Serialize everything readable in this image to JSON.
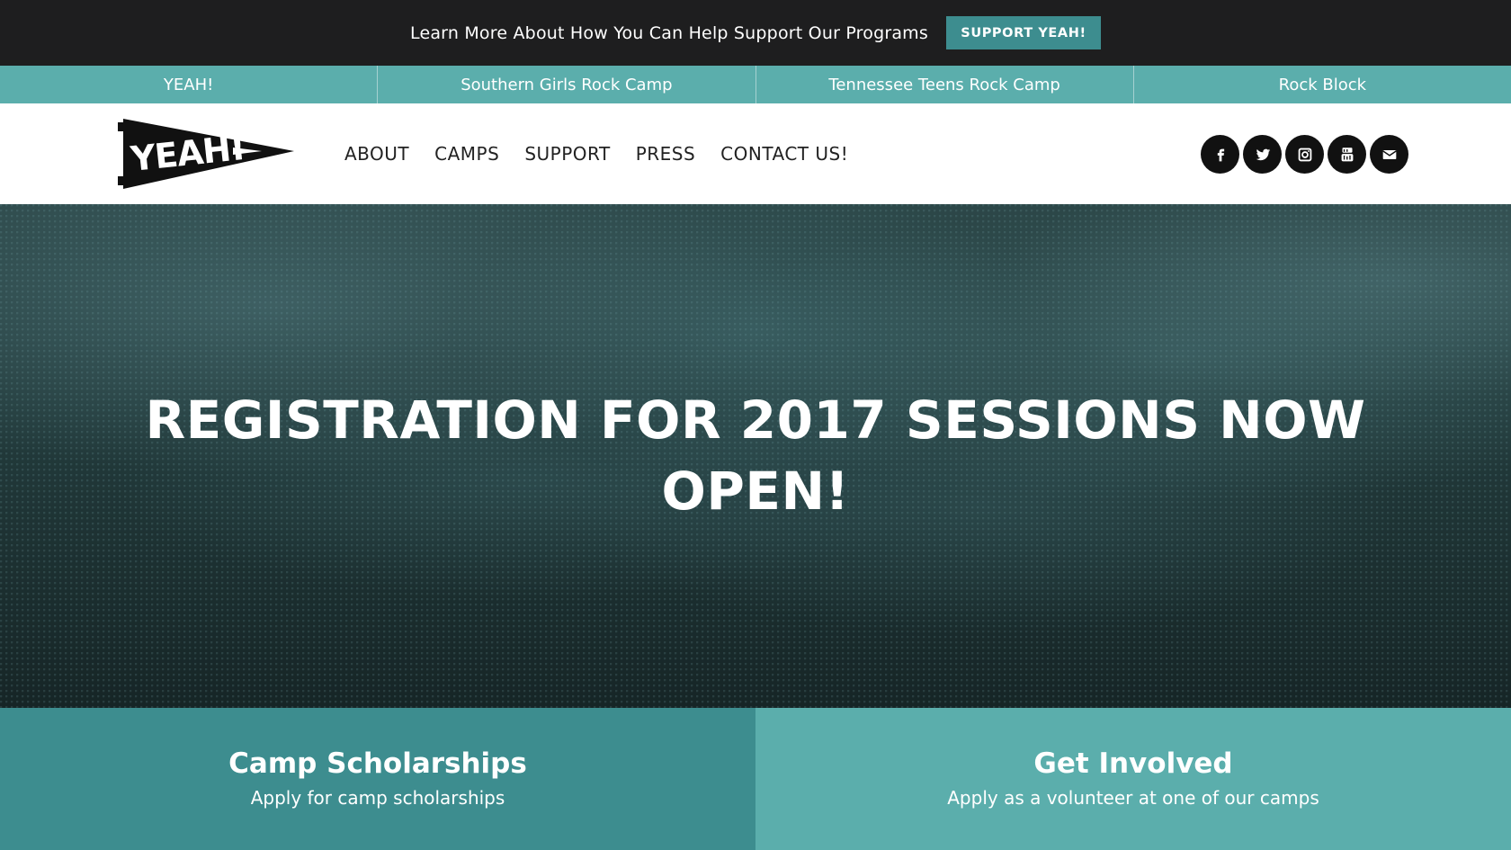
{
  "announcement": {
    "text": "Learn More About How You Can Help Support Our Programs",
    "button_label": "SUPPORT YEAH!"
  },
  "programs": [
    {
      "label": "YEAH!"
    },
    {
      "label": "Southern Girls Rock Camp"
    },
    {
      "label": "Tennessee Teens Rock Camp"
    },
    {
      "label": "Rock Block"
    }
  ],
  "logo": {
    "text": "YEAH!",
    "icon": "pennant-logo"
  },
  "nav": {
    "about": "ABOUT",
    "camps": "CAMPS",
    "support": "SUPPORT",
    "press": "PRESS",
    "contact": "CONTACT US!"
  },
  "social": [
    {
      "icon": "facebook-icon"
    },
    {
      "icon": "twitter-icon"
    },
    {
      "icon": "instagram-icon"
    },
    {
      "icon": "youtube-icon"
    },
    {
      "icon": "email-icon"
    }
  ],
  "hero": {
    "title": "REGISTRATION FOR 2017 SESSIONS NOW OPEN!"
  },
  "cards": [
    {
      "title": "Camp Scholarships",
      "subtitle": "Apply for camp scholarships"
    },
    {
      "title": "Get Involved",
      "subtitle": "Apply as a volunteer at one of our camps"
    }
  ],
  "colors": {
    "dark_bar": "#1e1e1f",
    "teal_dark": "#3d8d8f",
    "teal_light": "#5baeac",
    "text_dark": "#222222"
  }
}
